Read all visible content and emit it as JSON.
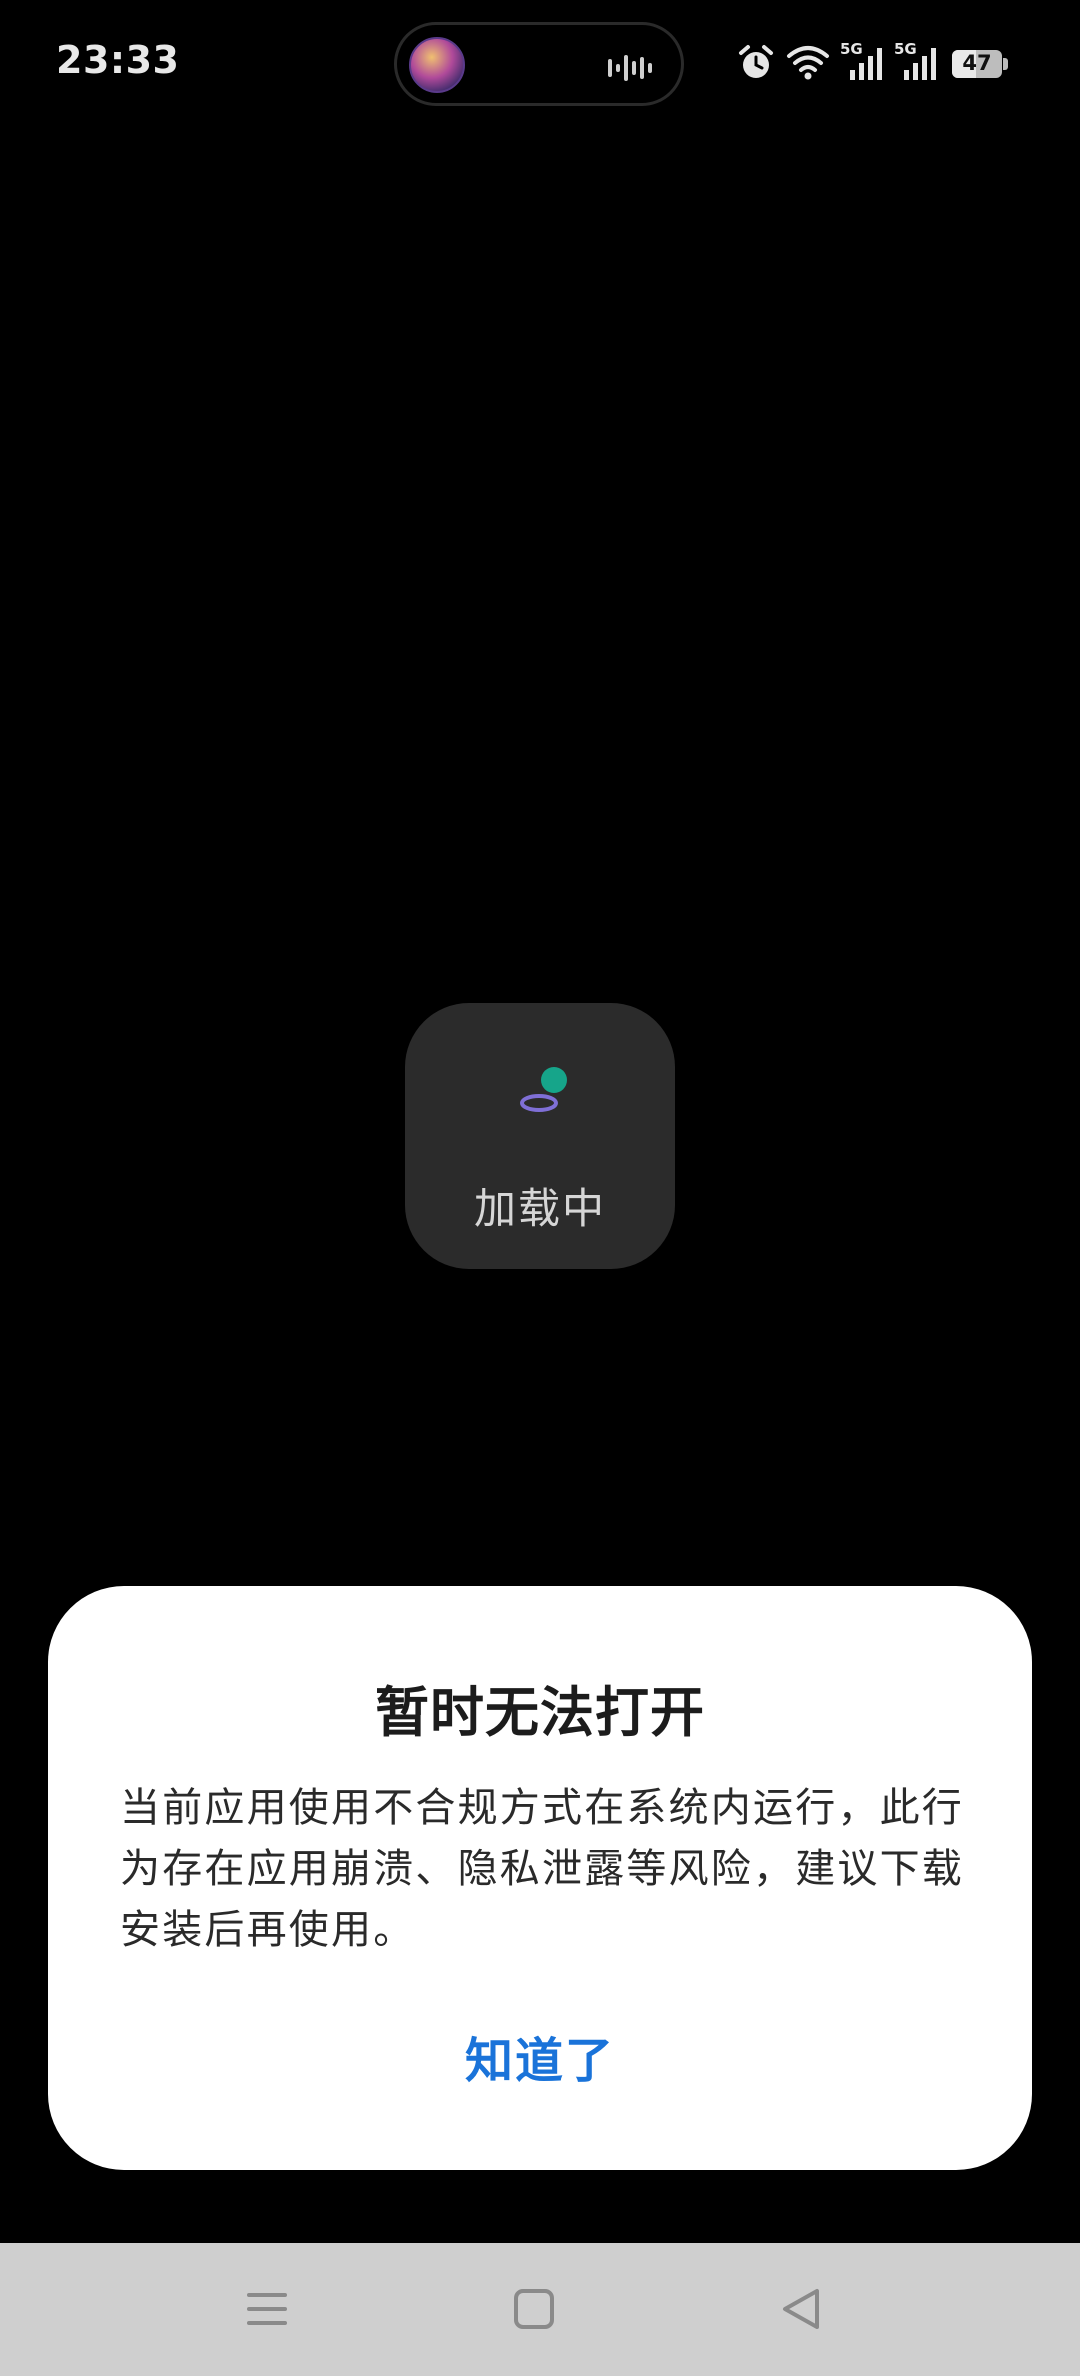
{
  "status_bar": {
    "time": "23:33",
    "network_1": "5G",
    "network_2": "5G",
    "battery_level": "47"
  },
  "loading": {
    "text": "加载中"
  },
  "dialog": {
    "title": "暂时无法打开",
    "message": "当前应用使用不合规方式在系统内运行，此行为存在应用崩溃、隐私泄露等风险，建议下载安装后再使用。",
    "confirm_label": "知道了"
  },
  "colors": {
    "accent": "#1a73d9",
    "loading_dot": "#16a58a",
    "loading_ring": "#7f6fd6"
  }
}
